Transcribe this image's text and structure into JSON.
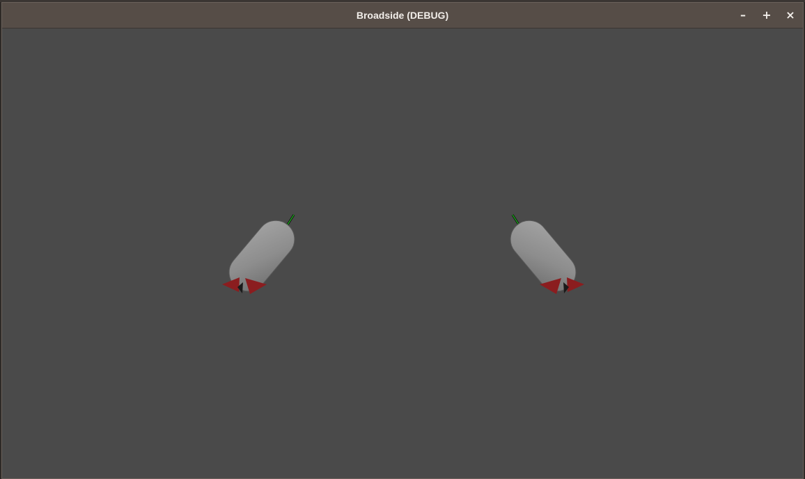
{
  "window": {
    "title": "Broadside (DEBUG)",
    "buttons": {
      "minimize": "–",
      "maximize": "+",
      "close": "×"
    }
  },
  "scene": {
    "background_color": "#4a4a4a",
    "ships": [
      {
        "id": "ship-left",
        "hull_color": "#8c8c8c",
        "thruster_color": "#8b1d1f",
        "heading_marker_color": "#1fa81f"
      },
      {
        "id": "ship-right",
        "hull_color": "#8c8c8c",
        "thruster_color": "#8b1d1f",
        "heading_marker_color": "#1fa81f"
      }
    ]
  }
}
